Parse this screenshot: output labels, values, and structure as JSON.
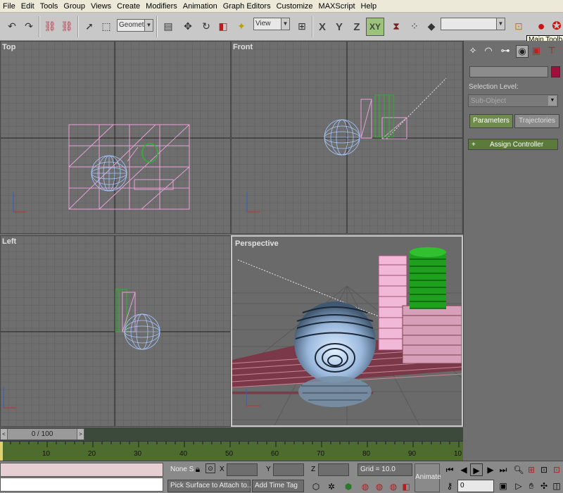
{
  "menubar": {
    "items": [
      "File",
      "Edit",
      "Tools",
      "Group",
      "Views",
      "Create",
      "Modifiers",
      "Animation",
      "Graph Editors",
      "Customize",
      "MAXScript",
      "Help"
    ]
  },
  "toolbar": {
    "selection_filter": "Geometry",
    "reference_coord": "View",
    "axis_x": "X",
    "axis_y": "Y",
    "axis_z": "Z",
    "axis_xy": "XY",
    "tooltip": "Main Toolbar",
    "named_selection": ""
  },
  "viewports": {
    "top": "Top",
    "front": "Front",
    "left": "Left",
    "perspective": "Perspective"
  },
  "command_panel": {
    "selection_level_label": "Selection Level:",
    "sub_object_label": "Sub-Object",
    "parameters_button": "Parameters",
    "trajectories_button": "Trajectories",
    "assign_controller_label": "Assign Controller",
    "expand_symbol": "+",
    "object_color": "#9e0f3c"
  },
  "time": {
    "slider_label": "0 / 100",
    "ticks": [
      "10",
      "20",
      "30",
      "40",
      "50",
      "60",
      "70",
      "80",
      "90",
      "10"
    ]
  },
  "statusbar": {
    "selection_label": "None S",
    "x_label": "X",
    "y_label": "Y",
    "z_label": "Z",
    "grid_label": "Grid = 10.0",
    "prompt": "Pick Surface to Attach to..",
    "add_time_tag": "Add Time Tag",
    "animate_button": "Animate",
    "frame_value": "0"
  }
}
